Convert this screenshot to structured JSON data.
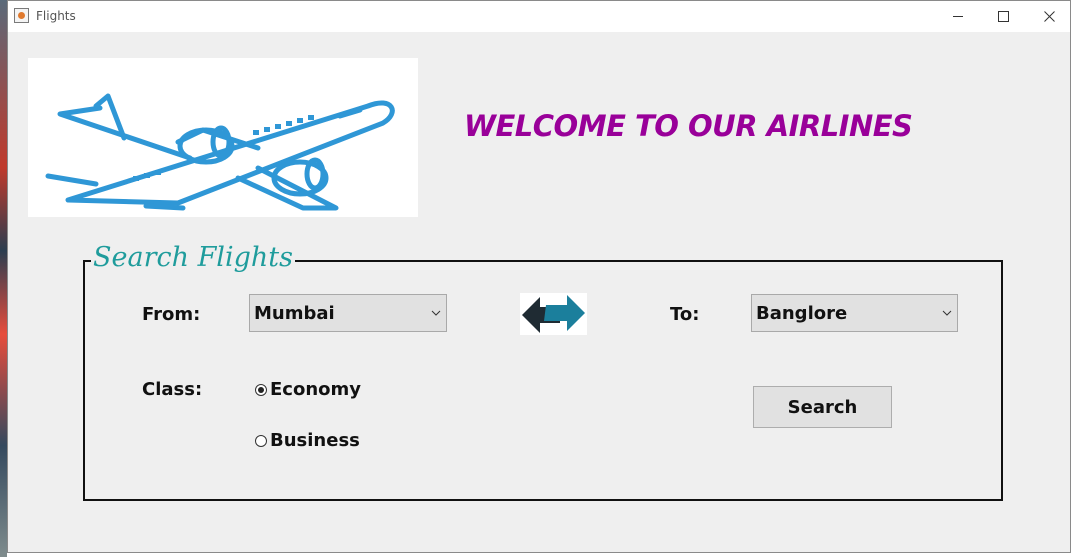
{
  "window": {
    "title": "Flights",
    "controls": {
      "minimize_icon": "minimize-icon",
      "maximize_icon": "maximize-icon",
      "close_icon": "close-icon"
    }
  },
  "header": {
    "welcome_text": "WELCOME TO OUR AIRLINES",
    "logo_icon": "airplane-icon"
  },
  "search": {
    "legend": "Search Flights",
    "from_label": "From:",
    "from_value": "Mumbai",
    "swap_icon": "swap-arrows-icon",
    "to_label": "To:",
    "to_value": "Banglore",
    "class_label": "Class:",
    "class_options": [
      {
        "label": "Economy",
        "selected": true
      },
      {
        "label": "Business",
        "selected": false
      }
    ],
    "search_button": "Search"
  },
  "colors": {
    "welcome": "#990099",
    "legend": "#1f9c9c",
    "plane": "#2f97d6"
  }
}
